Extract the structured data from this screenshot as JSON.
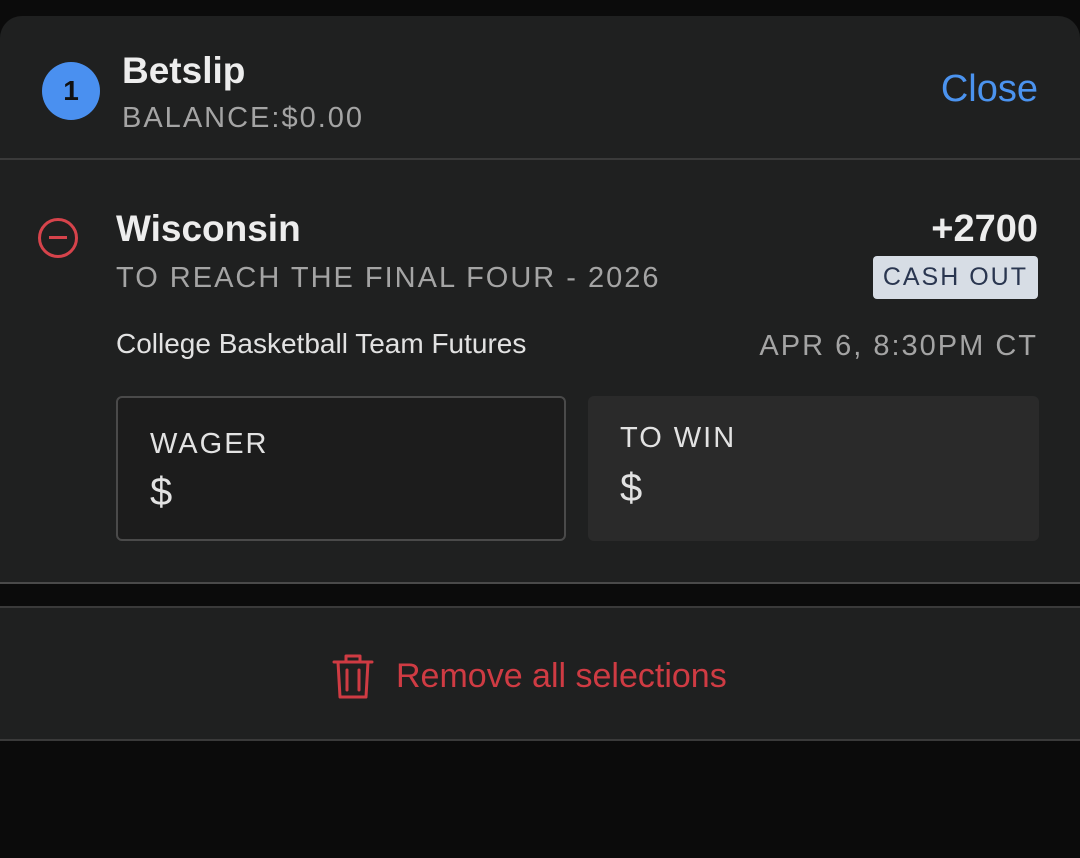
{
  "header": {
    "count": "1",
    "title": "Betslip",
    "balance": "BALANCE:$0.00",
    "close_label": "Close"
  },
  "selection": {
    "team": "Wisconsin",
    "market": "TO REACH THE FINAL FOUR - 2026",
    "odds": "+2700",
    "cash_out_label": "CASH OUT",
    "league": "College Basketball Team Futures",
    "datetime": "APR 6, 8:30PM CT",
    "wager": {
      "label": "WAGER",
      "value": "$"
    },
    "to_win": {
      "label": "TO WIN",
      "value": "$"
    }
  },
  "footer": {
    "remove_all_label": "Remove all selections"
  },
  "colors": {
    "accent_blue": "#4b93ef",
    "danger_red": "#cf3b43",
    "panel_bg": "#1f2020",
    "page_bg": "#0b0b0b"
  },
  "icons": {
    "remove_selection": "minus-circle-icon",
    "remove_all": "trash-icon"
  }
}
